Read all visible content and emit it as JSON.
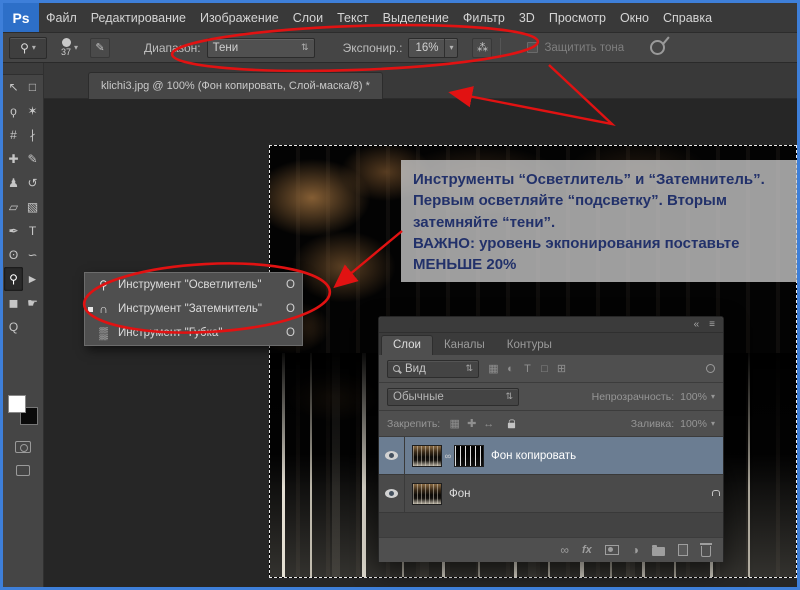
{
  "app": {
    "logo": "Ps"
  },
  "colors": {
    "annotation_red": "#e11212",
    "window_border": "#3e7fd9",
    "selected_layer": "#6b7d92"
  },
  "menubar": {
    "items": [
      "Файл",
      "Редактирование",
      "Изображение",
      "Слои",
      "Текст",
      "Выделение",
      "Фильтр",
      "3D",
      "Просмотр",
      "Окно",
      "Справка"
    ]
  },
  "options": {
    "preset_glyph": "⚲",
    "brush_size": "37",
    "panel_toggle_glyph": "✎",
    "range_label": "Диапазон:",
    "range_value": "Тени",
    "exposure_label": "Экспонир.:",
    "exposure_value": "16%",
    "airbrush_glyph": "⁂",
    "protect_label": "Защитить тона"
  },
  "glyphs": {
    "down_arrow": "▾",
    "updown_arrow": "⇅",
    "collapse": "«",
    "panel_menu": "≡",
    "adjustment": "◑",
    "link": "∞"
  },
  "tabbar": {
    "doc_title": "klichi3.jpg @ 100% (Фон копировать, Слой-маска/8) *"
  },
  "toolbar": {
    "tools": [
      {
        "name": "move-tool",
        "glyph": "↖",
        "selected": false
      },
      {
        "name": "marquee-tool",
        "glyph": "□",
        "selected": false
      },
      {
        "name": "lasso-tool",
        "glyph": "ϙ",
        "selected": false
      },
      {
        "name": "quick-selection-tool",
        "glyph": "✶",
        "selected": false
      },
      {
        "name": "crop-tool",
        "glyph": "#",
        "selected": false
      },
      {
        "name": "eyedropper-tool",
        "glyph": "∤",
        "selected": false
      },
      {
        "name": "healing-brush-tool",
        "glyph": "✚",
        "selected": false
      },
      {
        "name": "brush-tool",
        "glyph": "✎",
        "selected": false
      },
      {
        "name": "clone-stamp-tool",
        "glyph": "♟",
        "selected": false
      },
      {
        "name": "history-brush-tool",
        "glyph": "↺",
        "selected": false
      },
      {
        "name": "eraser-tool",
        "glyph": "▱",
        "selected": false
      },
      {
        "name": "gradient-tool",
        "glyph": "▧",
        "selected": false
      },
      {
        "name": "pen-tool",
        "glyph": "✒",
        "selected": false
      },
      {
        "name": "type-tool",
        "glyph": "T",
        "selected": false
      },
      {
        "name": "blur-tool",
        "glyph": "ʘ",
        "selected": false
      },
      {
        "name": "smudge-tool",
        "glyph": "∽",
        "selected": false
      },
      {
        "name": "dodge-tool",
        "glyph": "⚲",
        "selected": true
      },
      {
        "name": "path-selection-tool",
        "glyph": "►",
        "selected": false
      },
      {
        "name": "shape-tool",
        "glyph": "◼",
        "selected": false
      },
      {
        "name": "hand-tool",
        "glyph": "☛",
        "selected": false
      },
      {
        "name": "zoom-tool",
        "glyph": "Q",
        "selected": false
      }
    ]
  },
  "flyout": {
    "items": [
      {
        "icon": "⚲",
        "label": "Инструмент \"Осветлитель\"",
        "shortcut": "O",
        "current": false
      },
      {
        "icon": "∩",
        "label": "Инструмент \"Затемнитель\"",
        "shortcut": "O",
        "current": true
      },
      {
        "icon": "▒",
        "label": "Инструмент \"Губка\"",
        "shortcut": "O",
        "current": false
      }
    ]
  },
  "annotation": {
    "lines": [
      "Инструменты “Осветлитель” и “Затемнитель”.",
      "Первым осветляйте “подсветку”. Вторым",
      "затемняйте “тени”.",
      "ВАЖНО: уровень экпонирования поставьте",
      "МЕНЬШЕ 20%"
    ]
  },
  "layers_panel": {
    "tabs": [
      {
        "label": "Слои",
        "active": true
      },
      {
        "label": "Каналы",
        "active": false
      },
      {
        "label": "Контуры",
        "active": false
      }
    ],
    "filter_value": "Вид",
    "filter_icons": [
      "▦",
      "◐",
      "T",
      "□",
      "⊞"
    ],
    "blend_value": "Обычные",
    "opacity_label": "Непрозрачность:",
    "opacity_value": "100%",
    "lock_label": "Закрепить:",
    "lock_icons": [
      "▦",
      "✚",
      "↔"
    ],
    "fill_label": "Заливка:",
    "fill_value": "100%",
    "fx_label": "fx",
    "layers": [
      {
        "name": "Фон копировать",
        "selected": true,
        "mask": true,
        "locked": false
      },
      {
        "name": "Фон",
        "selected": false,
        "mask": false,
        "locked": true
      }
    ]
  }
}
